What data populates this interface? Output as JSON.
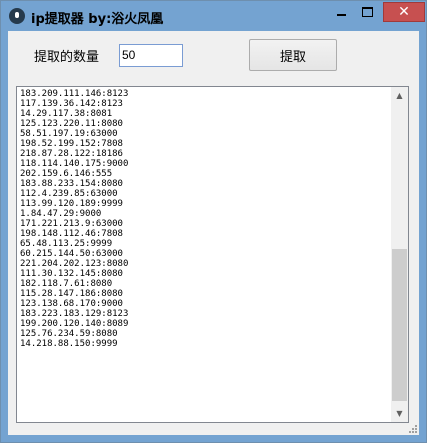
{
  "window": {
    "title": "ip提取器 by:浴火凤凰",
    "icon": "app-logo-icon",
    "controls": {
      "minimize": "minimize-icon",
      "maximize": "maximize-icon",
      "close": "close-icon"
    },
    "close_glyph": "✕"
  },
  "form": {
    "quantity_label": "提取的数量",
    "quantity_value": "50",
    "fetch_button": "提取"
  },
  "ip_list": [
    "183.209.111.146:8123",
    "117.139.36.142:8123",
    "14.29.117.38:8081",
    "125.123.220.11:8080",
    "58.51.197.19:63000",
    "198.52.199.152:7808",
    "218.87.28.122:18186",
    "118.114.140.175:9000",
    "202.159.6.146:555",
    "183.88.233.154:8080",
    "112.4.239.85:63000",
    "113.99.120.189:9999",
    "1.84.47.29:9000",
    "171.221.213.9:63000",
    "198.148.112.46:7808",
    "65.48.113.25:9999",
    "60.215.144.50:63000",
    "221.204.202.123:8080",
    "111.30.132.145:8080",
    "182.118.7.61:8080",
    "115.28.147.186:8080",
    "123.138.68.170:9000",
    "183.223.183.129:8123",
    "199.200.120.140:8089",
    "125.76.234.59:8080",
    "14.218.88.150:9999"
  ],
  "scrollbar": {
    "up_glyph": "▲",
    "down_glyph": "▼",
    "position": 0.48
  },
  "colors": {
    "titlebar": "#74a3d1",
    "close_button": "#c75050"
  }
}
